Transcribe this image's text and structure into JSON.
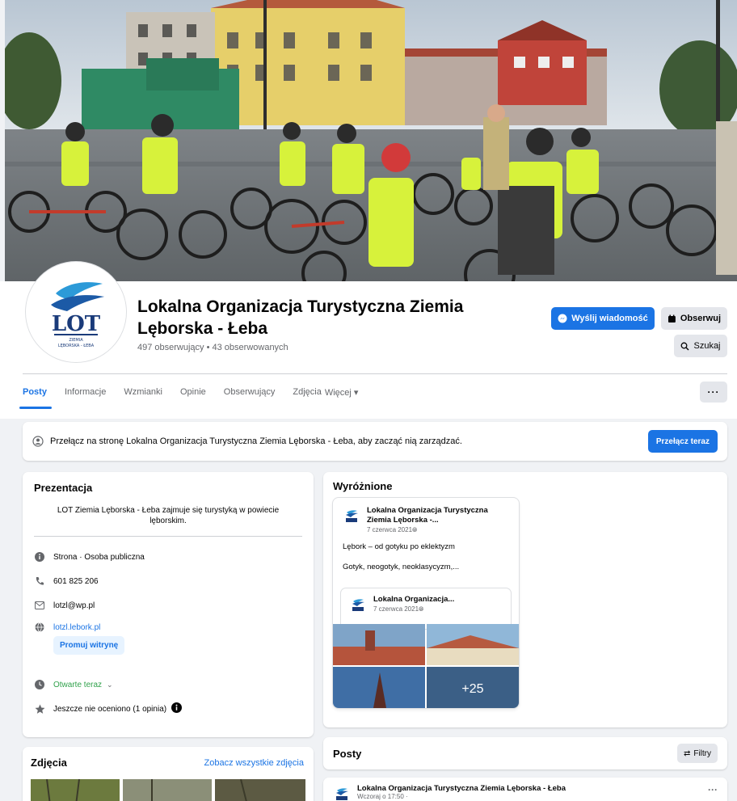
{
  "header": {
    "page_name": "Lokalna Organizacja Turystyczna Ziemia Lęborska - Łeba",
    "stats": "497 obserwujący • 43 obserwowanych",
    "message_button": "Wyślij wiadomość",
    "follow_button": "Obserwuj",
    "search_button": "Szukaj"
  },
  "logo": {
    "text": "LOT",
    "subtext_1": "ZIEMIA",
    "subtext_2": "LĘBORSKA - ŁEBA"
  },
  "tabs": [
    {
      "label": "Posty",
      "active": true
    },
    {
      "label": "Informacje",
      "active": false
    },
    {
      "label": "Wzmianki",
      "active": false
    },
    {
      "label": "Opinie",
      "active": false
    },
    {
      "label": "Obserwujący",
      "active": false
    },
    {
      "label": "Zdjęcia",
      "active": false
    },
    {
      "label": "Więcej ▾",
      "active": false
    }
  ],
  "tabs_more": "···",
  "switch_banner": {
    "text": "Przełącz na stronę Lokalna Organizacja Turystyczna Ziemia Lęborska - Łeba, aby zacząć nią zarządzać.",
    "button": "Przełącz teraz"
  },
  "intro": {
    "title": "Prezentacja",
    "description": "LOT Ziemia Lęborska - Łeba zajmuje się turystyką w powiecie lęborskim.",
    "category": "Strona · Osoba publiczna",
    "phone": "601 825 206",
    "email": "lotzl@wp.pl",
    "website": "lotzl.lebork.pl",
    "promote_button": "Promuj witrynę",
    "hours": "Otwarte teraz",
    "rating": "Jeszcze nie oceniono (1 opinia)"
  },
  "photos": {
    "title": "Zdjęcia",
    "see_all": "Zobacz wszystkie zdjęcia"
  },
  "featured": {
    "title": "Wyróżnione",
    "post": {
      "author": "Lokalna Organizacja Turystyczna Ziemia Lęborska -...",
      "date": "7 czerwca 2021",
      "text_1": "Lębork – od gotyku po eklektyzm",
      "text_2": "Gotyk, neogotyk, neoklasycyzm,...",
      "inner_author": "Lokalna Organizacja...",
      "inner_date": "7 czerwca 2021",
      "more_photos": "+25"
    }
  },
  "posts": {
    "title": "Posty",
    "filters": "Filtry",
    "first_author": "Lokalna Organizacja Turystyczna Ziemia Lęborska - Łeba",
    "first_time": "Wczoraj o 17:50 · ",
    "menu": "···"
  },
  "colors": {
    "accent": "#1b74e4",
    "background": "#f0f2f5",
    "secondary_button": "#e4e6eb",
    "muted_text": "#65676b"
  }
}
